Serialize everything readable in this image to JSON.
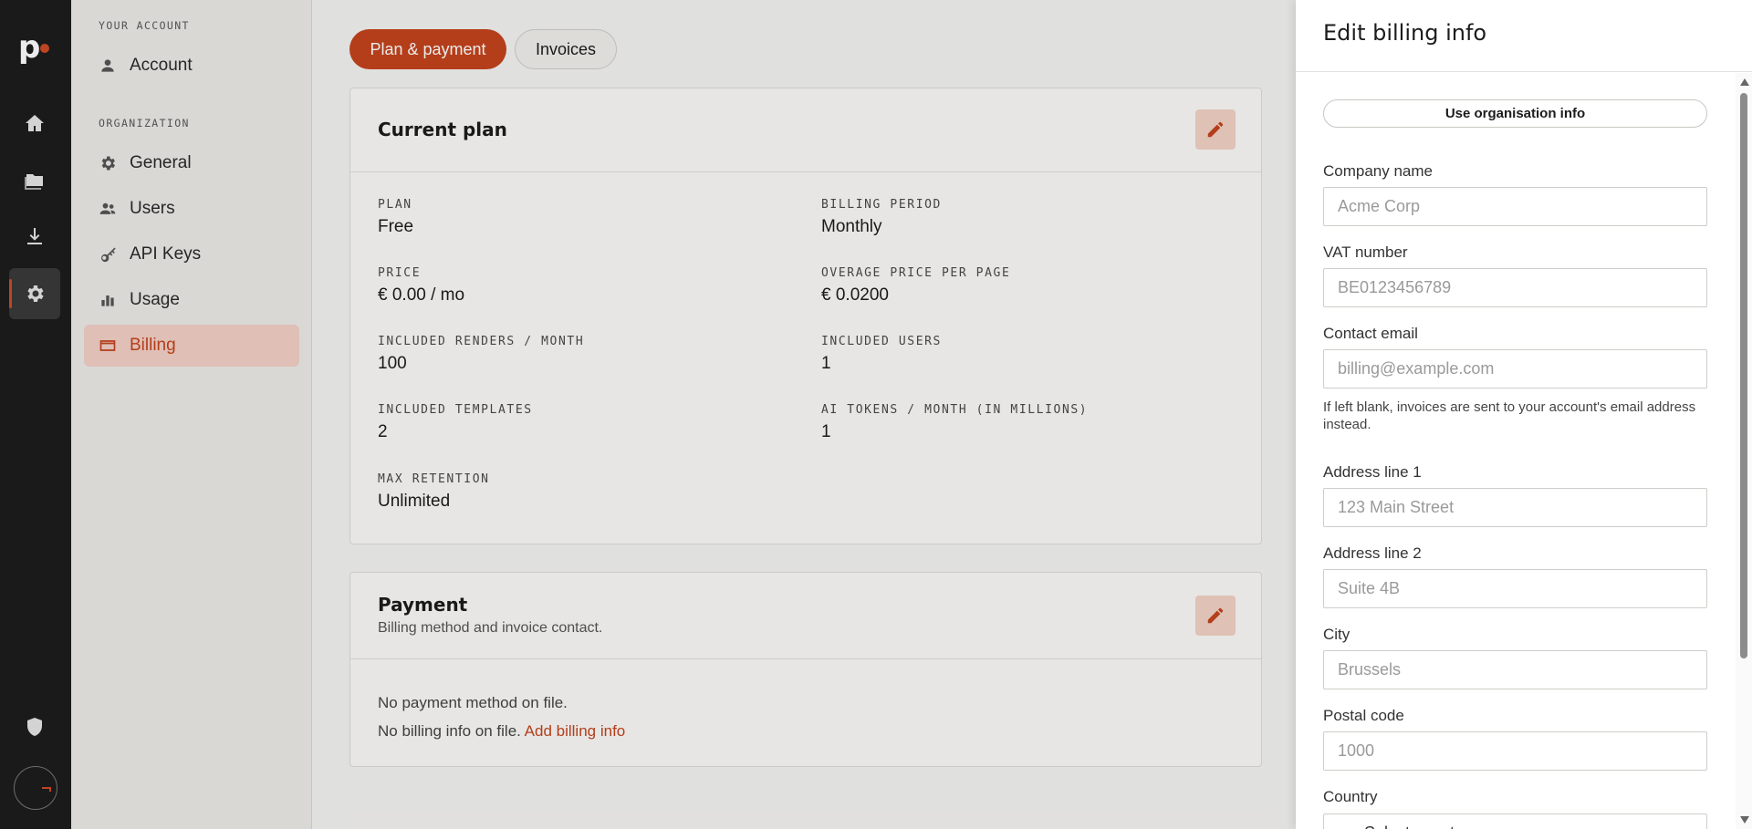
{
  "rail": {
    "logo_letter": "p",
    "icons": [
      "home-icon",
      "folder-icon",
      "download-icon",
      "settings-icon",
      "shield-icon"
    ],
    "accent_color": "#d04a25"
  },
  "sidebar": {
    "section_account": "YOUR ACCOUNT",
    "section_org": "ORGANIZATION",
    "items": [
      {
        "label": "Account",
        "icon": "user-icon"
      },
      {
        "label": "General",
        "icon": "gear-icon"
      },
      {
        "label": "Users",
        "icon": "users-icon"
      },
      {
        "label": "API Keys",
        "icon": "key-icon"
      },
      {
        "label": "Usage",
        "icon": "bar-chart-icon"
      },
      {
        "label": "Billing",
        "icon": "credit-card-icon",
        "active": true
      }
    ]
  },
  "tabs": [
    {
      "label": "Plan & payment",
      "active": true
    },
    {
      "label": "Invoices",
      "active": false
    }
  ],
  "current_plan": {
    "title": "Current plan",
    "fields": {
      "plan": {
        "label": "PLAN",
        "value": "Free"
      },
      "billing_period": {
        "label": "BILLING PERIOD",
        "value": "Monthly"
      },
      "price": {
        "label": "PRICE",
        "value": "€ 0.00 / mo"
      },
      "overage": {
        "label": "OVERAGE PRICE PER PAGE",
        "value": "€ 0.0200"
      },
      "renders": {
        "label": "INCLUDED RENDERS / MONTH",
        "value": "100"
      },
      "users": {
        "label": "INCLUDED USERS",
        "value": "1"
      },
      "templates": {
        "label": "INCLUDED TEMPLATES",
        "value": "2"
      },
      "ai_tokens": {
        "label": "AI TOKENS / MONTH (IN MILLIONS)",
        "value": "1"
      },
      "retention": {
        "label": "MAX RETENTION",
        "value": "Unlimited"
      }
    }
  },
  "payment": {
    "title": "Payment",
    "subtitle": "Billing method and invoice contact.",
    "no_method": "No payment method on file.",
    "no_billing": "No billing info on file.",
    "add_link": "Add billing info"
  },
  "drawer": {
    "title": "Edit billing info",
    "use_org_button": "Use organisation info",
    "company": {
      "label": "Company name",
      "placeholder": "Acme Corp"
    },
    "vat": {
      "label": "VAT number",
      "placeholder": "BE0123456789"
    },
    "email": {
      "label": "Contact email",
      "placeholder": "billing@example.com",
      "help": "If left blank, invoices are sent to your account's email address instead."
    },
    "address1": {
      "label": "Address line 1",
      "placeholder": "123 Main Street"
    },
    "address2": {
      "label": "Address line 2",
      "placeholder": "Suite 4B"
    },
    "city": {
      "label": "City",
      "placeholder": "Brussels"
    },
    "postal": {
      "label": "Postal code",
      "placeholder": "1000"
    },
    "country": {
      "label": "Country",
      "value": "Select country"
    }
  }
}
